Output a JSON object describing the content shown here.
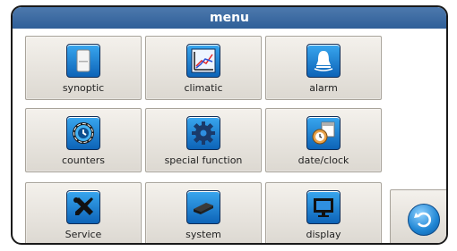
{
  "header": {
    "title": "menu"
  },
  "tiles": [
    {
      "label": "synoptic",
      "icon": "synoptic-cabinet-icon"
    },
    {
      "label": "climatic",
      "icon": "climatic-graph-icon"
    },
    {
      "label": "alarm",
      "icon": "alarm-bell-icon"
    },
    {
      "label": "counters",
      "icon": "counters-clock-icon"
    },
    {
      "label": "special function",
      "icon": "gear-icon"
    },
    {
      "label": "date/clock",
      "icon": "date-clock-icon"
    },
    {
      "label": "Service",
      "icon": "tools-icon"
    },
    {
      "label": "system",
      "icon": "system-device-icon"
    },
    {
      "label": "display",
      "icon": "monitor-icon"
    }
  ],
  "back_button": {
    "icon": "back-arrow-icon"
  },
  "colors": {
    "title_bar": "#3a6aa3",
    "tile_bg": "#e8e4de",
    "icon_blue": "#1e88dd"
  }
}
